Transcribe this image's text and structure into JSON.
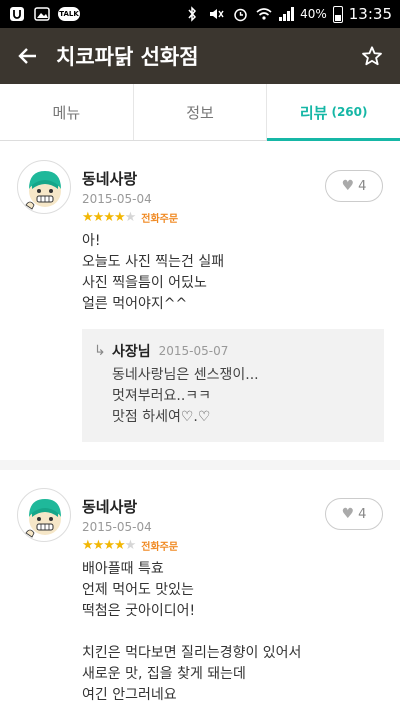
{
  "status_bar": {
    "talk_label": "TALK",
    "battery": "40%",
    "time": "13:35"
  },
  "header": {
    "title": "치코파닭 선화점",
    "back_icon": "arrow-left-icon",
    "favorite_icon": "star-outline-icon"
  },
  "tabs": [
    {
      "label": "메뉴",
      "count": ""
    },
    {
      "label": "정보",
      "count": ""
    },
    {
      "label": "리뷰",
      "count": "(260)"
    }
  ],
  "colors": {
    "accent": "#16b7a6",
    "header_bg": "#3b362f",
    "star": "#f2b705",
    "order_type": "#f08a24"
  },
  "reviews": [
    {
      "name": "동네사랑",
      "date": "2015-05-04",
      "rating": 4,
      "rating_max": 5,
      "order_type": "전화주문",
      "text": "아!\n오늘도 사진 찍는건 실패\n사진 찍을틈이 어딨노\n얼른 먹어야지^^",
      "likes": "4",
      "reply": {
        "owner": "사장님",
        "date": "2015-05-07",
        "text": "동네사랑님은 센스쟁이...\n멋져부러요..ㅋㅋ\n맛점 하세여♡.♡"
      }
    },
    {
      "name": "동네사랑",
      "date": "2015-05-04",
      "rating": 4,
      "rating_max": 5,
      "order_type": "전화주문",
      "text": "배아플때 특효\n언제 먹어도 맛있는\n떡첨은 굿아이디어!\n\n치킨은 먹다보면  질리는경향이 있어서\n새로운 맛, 집을 찾게 돼는데\n여긴 안그러네요",
      "likes": "4"
    }
  ]
}
